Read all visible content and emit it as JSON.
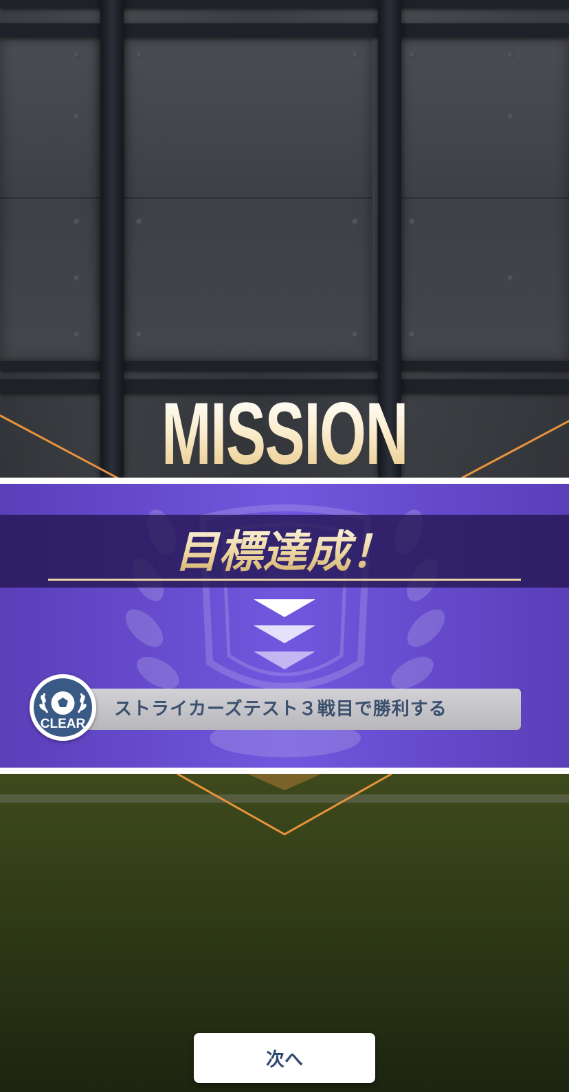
{
  "screen": {
    "heading": "MISSION CLEAR",
    "goal_banner": "目標達成！",
    "mission": {
      "badge_label": "CLEAR",
      "description": "ストライカーズテスト３戦目で勝利する"
    },
    "next_button_label": "次へ"
  },
  "colors": {
    "band_purple": "#7057de",
    "accent_orange": "#e8933c",
    "title_gold": "#e9c98a",
    "badge_blue": "#3a5a86",
    "text_navy": "#3b4f6e"
  },
  "icons": [
    "chevron-down-icon",
    "soccer-ball-icon",
    "laurel-icon",
    "trophy-emblem"
  ]
}
